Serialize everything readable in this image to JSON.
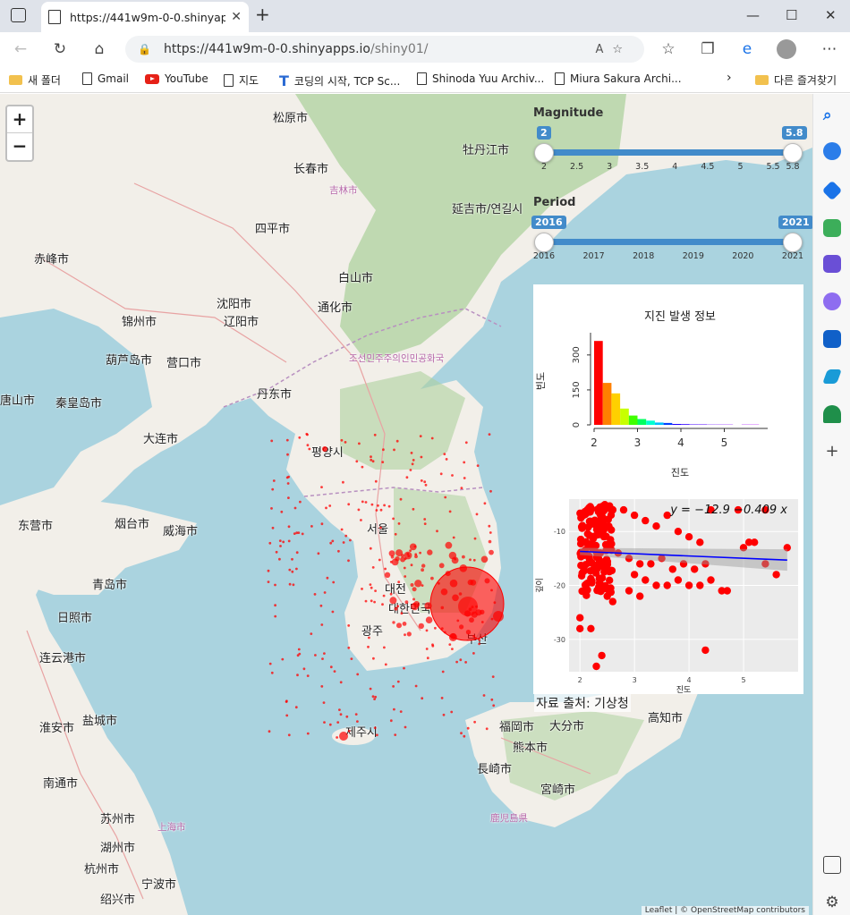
{
  "browser": {
    "tab_title": "https://441w9m-0-0.shinyapps.i",
    "url_host": "https://441w9m-0-0.shinyapps.io",
    "url_path": "/shiny01/",
    "bookmarks": [
      "새 폴더",
      "Gmail",
      "YouTube",
      "지도",
      "코딩의 시작, TCP Sc...",
      "Shinoda Yuu Archiv...",
      "Miura Sakura Archi..."
    ],
    "other_bookmarks": "다른 즐겨찾기"
  },
  "map": {
    "zoom_in": "+",
    "zoom_out": "−",
    "labels": [
      {
        "t": "松原市",
        "x": 305,
        "y": 16,
        "c": "big"
      },
      {
        "t": "牡丹江市",
        "x": 517,
        "y": 52,
        "c": "big"
      },
      {
        "t": "长春市",
        "x": 328,
        "y": 73,
        "c": "big"
      },
      {
        "t": "吉林市",
        "x": 368,
        "y": 100,
        "c": "prov"
      },
      {
        "t": "延吉市/연길시",
        "x": 505,
        "y": 118,
        "c": "big"
      },
      {
        "t": "四平市",
        "x": 285,
        "y": 140,
        "c": "big"
      },
      {
        "t": "沈阳市",
        "x": 242,
        "y": 224,
        "c": "big"
      },
      {
        "t": "辽阳市",
        "x": 250,
        "y": 244,
        "c": "big"
      },
      {
        "t": "通化市",
        "x": 355,
        "y": 228,
        "c": "big"
      },
      {
        "t": "白山市",
        "x": 378,
        "y": 195,
        "c": "big"
      },
      {
        "t": "丹东市",
        "x": 287,
        "y": 325,
        "c": "big"
      },
      {
        "t": "조선민주주의인민공화국",
        "x": 390,
        "y": 288,
        "c": "prov"
      },
      {
        "t": "평양시",
        "x": 348,
        "y": 390,
        "c": "big"
      },
      {
        "t": "서울",
        "x": 410,
        "y": 476,
        "c": "big"
      },
      {
        "t": "대전",
        "x": 430,
        "y": 543,
        "c": "big"
      },
      {
        "t": "대한민국",
        "x": 434,
        "y": 565,
        "c": "big"
      },
      {
        "t": "광주",
        "x": 404,
        "y": 590,
        "c": "big"
      },
      {
        "t": "부산",
        "x": 521,
        "y": 599,
        "c": "big"
      },
      {
        "t": "제주시",
        "x": 386,
        "y": 703,
        "c": "big"
      },
      {
        "t": "大连市",
        "x": 160,
        "y": 375,
        "c": "big"
      },
      {
        "t": "烟台市",
        "x": 128,
        "y": 470,
        "c": "big"
      },
      {
        "t": "威海市",
        "x": 182,
        "y": 478,
        "c": "big"
      },
      {
        "t": "青岛市",
        "x": 103,
        "y": 538,
        "c": "big"
      },
      {
        "t": "日照市",
        "x": 64,
        "y": 575,
        "c": "big"
      },
      {
        "t": "连云港市",
        "x": 44,
        "y": 620,
        "c": "big"
      },
      {
        "t": "盐城市",
        "x": 92,
        "y": 690,
        "c": "big"
      },
      {
        "t": "南通市",
        "x": 48,
        "y": 760,
        "c": "big"
      },
      {
        "t": "苏州市",
        "x": 112,
        "y": 800,
        "c": "big"
      },
      {
        "t": "上海市",
        "x": 176,
        "y": 812,
        "c": "prov"
      },
      {
        "t": "湖州市",
        "x": 112,
        "y": 832,
        "c": "big"
      },
      {
        "t": "杭州市",
        "x": 94,
        "y": 856,
        "c": "big"
      },
      {
        "t": "宁波市",
        "x": 158,
        "y": 873,
        "c": "big"
      },
      {
        "t": "绍兴市",
        "x": 112,
        "y": 890,
        "c": "big"
      },
      {
        "t": "福岡市",
        "x": 558,
        "y": 697,
        "c": "big"
      },
      {
        "t": "熊本市",
        "x": 573,
        "y": 720,
        "c": "big"
      },
      {
        "t": "長崎市",
        "x": 533,
        "y": 744,
        "c": "big"
      },
      {
        "t": "宮崎市",
        "x": 604,
        "y": 767,
        "c": "big"
      },
      {
        "t": "鹿児島県",
        "x": 548,
        "y": 802,
        "c": "prov"
      },
      {
        "t": "大分市",
        "x": 614,
        "y": 696,
        "c": "big"
      },
      {
        "t": "高知市",
        "x": 724,
        "y": 687,
        "c": "big"
      },
      {
        "t": "赤峰市",
        "x": 38,
        "y": 174,
        "c": "big"
      },
      {
        "t": "锦州市",
        "x": 136,
        "y": 244,
        "c": "big"
      },
      {
        "t": "葫芦岛市",
        "x": 118,
        "y": 287,
        "c": "big"
      },
      {
        "t": "营口市",
        "x": 186,
        "y": 290,
        "c": "big"
      },
      {
        "t": "秦皇岛市",
        "x": 62,
        "y": 335,
        "c": "big"
      },
      {
        "t": "唐山市",
        "x": 0,
        "y": 332,
        "c": "big"
      },
      {
        "t": "东营市",
        "x": 20,
        "y": 472,
        "c": "big"
      },
      {
        "t": "淮安市",
        "x": 44,
        "y": 698,
        "c": "big"
      }
    ]
  },
  "sliders": {
    "magnitude": {
      "title": "Magnitude",
      "min": 2,
      "max": 5.8,
      "lo": 2,
      "hi": 5.8,
      "lo_label": "2",
      "hi_label": "5.8",
      "ticks": [
        "2",
        "2.5",
        "3",
        "3.5",
        "4",
        "4.5",
        "5",
        "5.5",
        "5.8"
      ]
    },
    "period": {
      "title": "Period",
      "min": 2016,
      "max": 2021,
      "lo": 2016,
      "hi": 2021,
      "lo_label": "2016",
      "hi_label": "2021",
      "ticks": [
        "2016",
        "2017",
        "2018",
        "2019",
        "2020",
        "2021"
      ]
    }
  },
  "panel": {
    "histogram_title": "지진 발생 정보",
    "source": "자료 출처: 기상청"
  },
  "chart_data": [
    {
      "type": "bar",
      "title": "지진 발생 정보",
      "xlabel": "진도",
      "ylabel": "빈도",
      "x_ticks": [
        "2",
        "3",
        "4",
        "5"
      ],
      "y_ticks": [
        "0",
        "150",
        "300"
      ],
      "xlim": [
        2,
        6
      ],
      "ylim": [
        0,
        380
      ],
      "bins": [
        2.0,
        2.2,
        2.4,
        2.6,
        2.8,
        3.0,
        3.2,
        3.4,
        3.6,
        3.8,
        4.0,
        4.2,
        4.4,
        4.6,
        4.8,
        5.0,
        5.2,
        5.4,
        5.6
      ],
      "values": [
        360,
        180,
        135,
        70,
        40,
        25,
        18,
        10,
        8,
        4,
        3,
        2,
        2,
        1,
        1,
        1,
        0,
        1,
        1
      ],
      "colors": [
        "#ff0000",
        "#ff8000",
        "#ffd000",
        "#c8ff00",
        "#40ff00",
        "#00ff60",
        "#00ffd0",
        "#00c0ff",
        "#0040ff",
        "#2000ff",
        "#3000ff",
        "#4000ff",
        "#5000ff",
        "#6000ff",
        "#7000ff",
        "#8000ff",
        "#9000ff",
        "#a000ff",
        "#b000ff"
      ]
    },
    {
      "type": "scatter",
      "xlabel": "진도",
      "ylabel": "깊이",
      "equation": "y = −12.9 −0.409 x",
      "x_ticks": [
        "2",
        "3",
        "4",
        "5"
      ],
      "y_ticks": [
        "-10",
        "-20",
        "-30"
      ],
      "xlim": [
        1.8,
        6.0
      ],
      "ylim": [
        -36,
        -4
      ],
      "points": [
        [
          2.6,
          -6
        ],
        [
          2.8,
          -6
        ],
        [
          3.0,
          -7
        ],
        [
          3.2,
          -8
        ],
        [
          3.4,
          -9
        ],
        [
          3.6,
          -7
        ],
        [
          3.8,
          -10
        ],
        [
          4.0,
          -11
        ],
        [
          4.2,
          -12
        ],
        [
          4.4,
          -6
        ],
        [
          4.9,
          -6
        ],
        [
          5.4,
          -6
        ],
        [
          5.1,
          -12
        ],
        [
          5.2,
          -12
        ],
        [
          5.0,
          -13
        ],
        [
          5.8,
          -13
        ],
        [
          2.7,
          -14
        ],
        [
          2.9,
          -15
        ],
        [
          3.1,
          -16
        ],
        [
          3.3,
          -16
        ],
        [
          3.5,
          -15
        ],
        [
          3.7,
          -17
        ],
        [
          3.9,
          -16
        ],
        [
          4.1,
          -17
        ],
        [
          4.3,
          -16
        ],
        [
          3.0,
          -18
        ],
        [
          3.2,
          -19
        ],
        [
          3.6,
          -20
        ],
        [
          3.8,
          -19
        ],
        [
          4.0,
          -20
        ],
        [
          4.4,
          -19
        ],
        [
          5.4,
          -16
        ],
        [
          5.6,
          -18
        ],
        [
          4.6,
          -21
        ],
        [
          4.7,
          -21
        ],
        [
          2.5,
          -22
        ],
        [
          2.6,
          -23
        ],
        [
          2.9,
          -21
        ],
        [
          3.1,
          -22
        ],
        [
          2.0,
          -26
        ],
        [
          2.0,
          -28
        ],
        [
          2.2,
          -28
        ],
        [
          2.4,
          -33
        ],
        [
          2.3,
          -35
        ],
        [
          4.3,
          -32
        ],
        [
          4.2,
          -20
        ],
        [
          3.4,
          -20
        ]
      ],
      "fit": {
        "x": [
          2.0,
          5.8
        ],
        "y": [
          -13.7,
          -15.3
        ]
      }
    }
  ],
  "colors": {
    "quake": "#ff0000",
    "slider": "#428bca",
    "map_sea": "#aad3df",
    "map_land": "#f2efe9"
  },
  "attribution": "Leaflet | © OpenStreetMap contributors"
}
